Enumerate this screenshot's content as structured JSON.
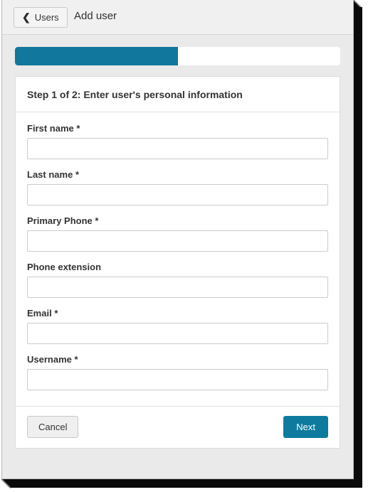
{
  "window": {
    "nav": {
      "back_button": {
        "icon": "chevron-left-icon",
        "label": "Users"
      },
      "title": "Add user"
    },
    "progress": {
      "percent": 50
    },
    "card": {
      "header": "Step 1 of 2: Enter user's personal information",
      "fields": [
        {
          "label": "First name",
          "required": "*",
          "value": "",
          "placeholder": "",
          "name": "first-name"
        },
        {
          "label": "Last name",
          "required": "*",
          "value": "",
          "placeholder": "",
          "name": "last-name"
        },
        {
          "label": "Primary Phone",
          "required": "*",
          "value": "",
          "placeholder": "",
          "name": "primary-phone"
        },
        {
          "label": "Phone extension",
          "required": "",
          "value": "",
          "placeholder": "",
          "name": "phone-extension"
        },
        {
          "label": "Email",
          "required": "*",
          "value": "",
          "placeholder": "",
          "name": "email"
        },
        {
          "label": "Username",
          "required": "*",
          "value": "",
          "placeholder": "",
          "name": "username"
        }
      ],
      "footer": {
        "cancel_label": "Cancel",
        "next_label": "Next"
      }
    }
  },
  "colors": {
    "accent": "#0e7b9e",
    "progress_fill": "#11779c",
    "nav_bg": "#f0f0f0",
    "page_bg": "#eaeaea",
    "card_bg": "#ffffff",
    "border": "#dddddd"
  }
}
